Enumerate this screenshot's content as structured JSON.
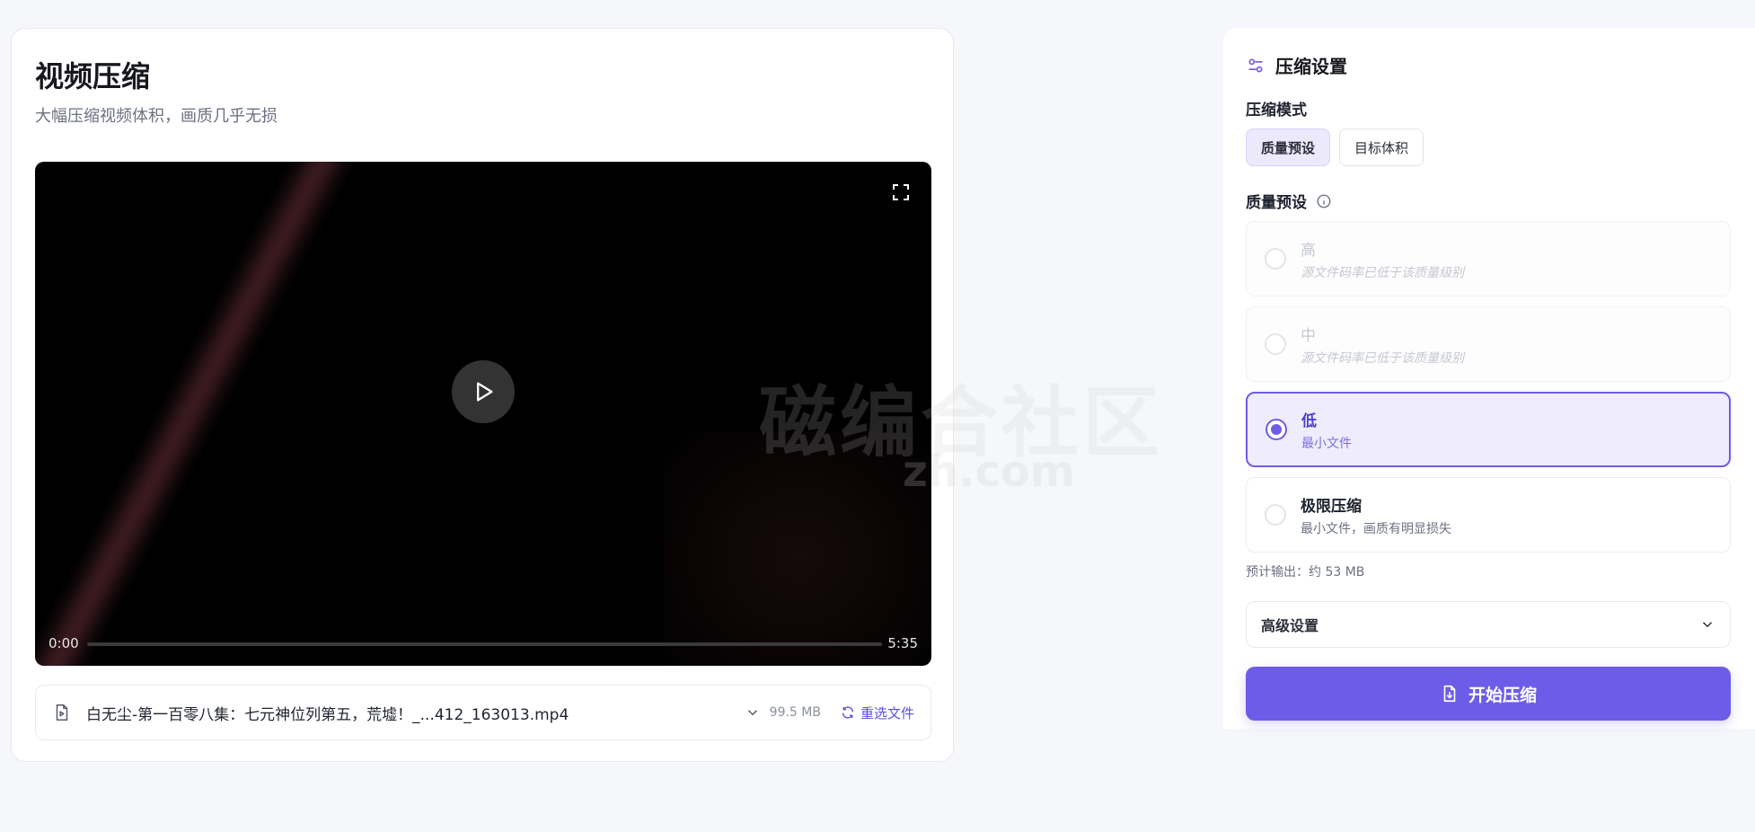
{
  "left": {
    "title": "视频压缩",
    "subtitle": "大幅压缩视频体积，画质几乎无损",
    "player": {
      "time_current": "0:00",
      "time_total": "5:35",
      "progress_fraction": 0.0
    },
    "file": {
      "name": "白无尘-第一百零八集：七元神位列第五，荒墟！_...412_163013.mp4",
      "size": "99.5 MB",
      "reselect_label": "重选文件"
    }
  },
  "watermark": {
    "main": "磁编合社区",
    "sub": "zh.com"
  },
  "settings": {
    "title": "压缩设置",
    "mode_label": "压缩模式",
    "modes": [
      {
        "label": "质量预设",
        "active": true
      },
      {
        "label": "目标体积",
        "active": false
      }
    ],
    "preset_label": "质量预设",
    "options": [
      {
        "title": "高",
        "desc": "源文件码率已低于该质量级别",
        "state": "disabled"
      },
      {
        "title": "中",
        "desc": "源文件码率已低于该质量级别",
        "state": "disabled"
      },
      {
        "title": "低",
        "desc": "最小文件",
        "state": "selected"
      },
      {
        "title": "极限压缩",
        "desc": "最小文件，画质有明显损失",
        "state": "normal"
      }
    ],
    "estimate": "预计输出：约 53 MB",
    "advanced_label": "高级设置",
    "start_label": "开始压缩"
  },
  "colors": {
    "accent": "#6c5ce7",
    "accent_light": "#efedfd"
  }
}
